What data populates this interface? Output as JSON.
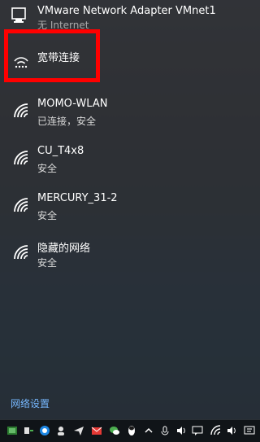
{
  "vmware": {
    "name": "VMware Network Adapter VMnet1",
    "status": "无 Internet"
  },
  "broadband": {
    "name": "宽带连接"
  },
  "networks": [
    {
      "name": "MOMO-WLAN",
      "status": "已连接，安全"
    },
    {
      "name": "CU_T4x8",
      "status": "安全"
    },
    {
      "name": "MERCURY_31-2",
      "status": "安全"
    },
    {
      "name": "隐藏的网络",
      "status": "安全"
    }
  ],
  "footer": {
    "settings_link": "网络设置"
  },
  "taskbar": {
    "icons": [
      "app-green-icon",
      "usb-icon",
      "shield-icon",
      "user-icon",
      "send-icon",
      "mail-icon",
      "wechat-icon",
      "qq-icon",
      "chevron-up-icon",
      "mic-off-icon",
      "volume-icon",
      "message-icon",
      "wifi-icon",
      "volume-icon-2",
      "notification-icon"
    ]
  },
  "colors": {
    "highlight": "#ff0000",
    "link": "#77b8ff"
  }
}
